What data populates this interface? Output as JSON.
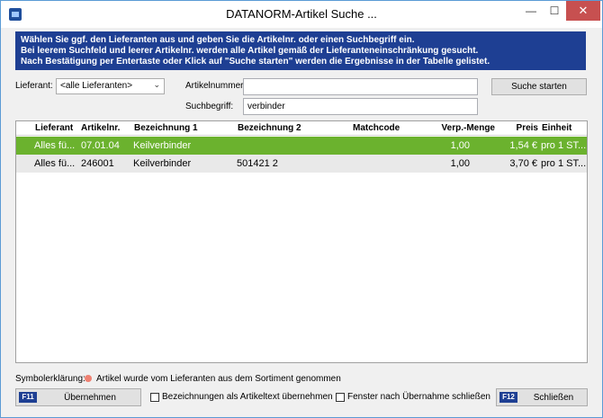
{
  "window": {
    "title": "DATANORM-Artikel Suche ...",
    "minimize": "—",
    "maximize": "☐",
    "close": "✕"
  },
  "info": {
    "line1": "Wählen Sie ggf. den Lieferanten aus und geben Sie die Artikelnr. oder einen Suchbegriff ein.",
    "line2": "Bei leerem Suchfeld und leerer Artikelnr. werden alle Artikel gemäß der Lieferanteneinschränkung gesucht.",
    "line3": "Nach Bestätigung per Entertaste oder Klick auf \"Suche starten\" werden die Ergebnisse in der Tabelle gelistet."
  },
  "filters": {
    "supplier_label": "Lieferant:",
    "supplier_value": "<alle Lieferanten>",
    "article_label": "Artikelnummer:",
    "article_value": "",
    "search_label": "Suchbegriff:",
    "search_value": "verbinder",
    "search_button": "Suche starten"
  },
  "table": {
    "headers": {
      "supplier": "Lieferant",
      "article": "Artikelnr.",
      "desc1": "Bezeichnung 1",
      "desc2": "Bezeichnung 2",
      "matchcode": "Matchcode",
      "pack": "Verp.-Menge",
      "price": "Preis",
      "unit": "Einheit"
    },
    "rows": [
      {
        "supplier": "Alles fü...",
        "article": "07.01.04",
        "desc1": "Keilverbinder",
        "desc2": "",
        "matchcode": "",
        "pack": "1,00",
        "price": "1,54 €",
        "unit": "pro 1 ST..."
      },
      {
        "supplier": "Alles fü...",
        "article": "246001",
        "desc1": "Keilverbinder",
        "desc2": "501421 2",
        "matchcode": "",
        "pack": "1,00",
        "price": "3,70 €",
        "unit": "pro 1 ST..."
      }
    ]
  },
  "legend": {
    "label": "Symbolerklärung:",
    "description": "Artikel wurde vom Lieferanten aus dem Sortiment genommen"
  },
  "footer": {
    "apply_key": "F11",
    "apply_label": "Übernehmen",
    "checkbox1_label": "Bezeichnungen als Artikeltext übernehmen",
    "checkbox2_label": "Fenster nach Übernahme schließen",
    "close_key": "F12",
    "close_label": "Schließen"
  },
  "colors": {
    "info_background": "#1e3f93",
    "selected_row": "#6bb22e",
    "legend_dot": "#ef8273"
  }
}
